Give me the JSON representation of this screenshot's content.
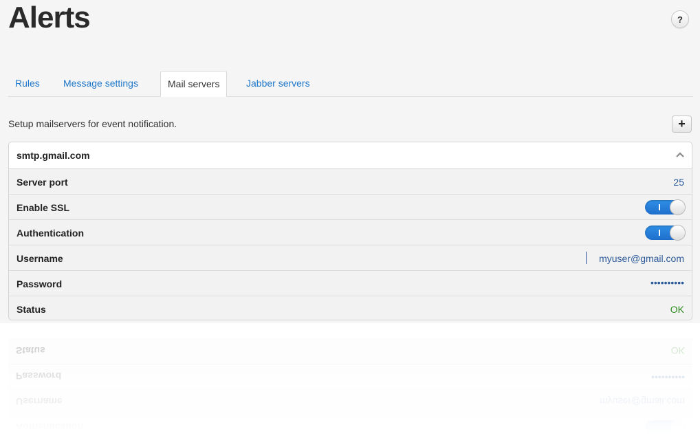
{
  "page": {
    "title": "Alerts",
    "help_label": "?"
  },
  "tabs": [
    {
      "label": "Rules",
      "active": false
    },
    {
      "label": "Message settings",
      "active": false
    },
    {
      "label": "Mail servers",
      "active": true
    },
    {
      "label": "Jabber servers",
      "active": false
    }
  ],
  "description": "Setup mailservers for event notification.",
  "add_label": "+",
  "server": {
    "name": "smtp.gmail.com",
    "rows": {
      "port": {
        "label": "Server port",
        "value": "25"
      },
      "ssl": {
        "label": "Enable SSL",
        "enabled": true
      },
      "auth": {
        "label": "Authentication",
        "enabled": true
      },
      "username": {
        "label": "Username",
        "value": "myuser@gmail.com"
      },
      "password": {
        "label": "Password",
        "value": "••••••••••"
      },
      "status": {
        "label": "Status",
        "value": "OK"
      }
    }
  },
  "icons": {
    "help": "help-icon",
    "add": "plus-icon",
    "collapse": "chevron-up-icon"
  },
  "colors": {
    "accent": "#1f77c9",
    "toggle_on": "#2b85e0",
    "status_ok": "#2e8b1e",
    "value_text": "#2a5a9a"
  }
}
